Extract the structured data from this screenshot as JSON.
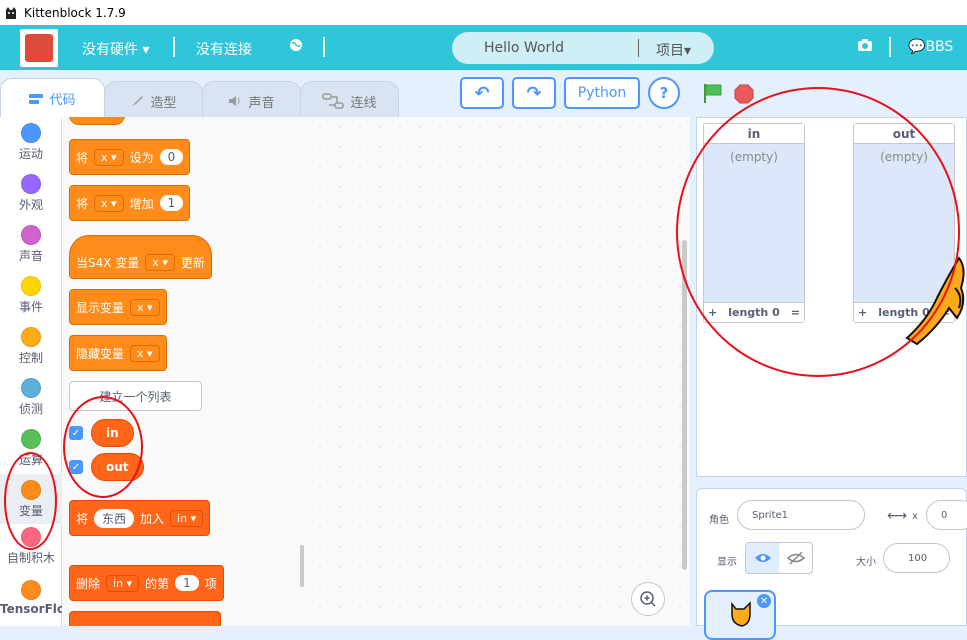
{
  "window": {
    "title": "Kittenblock 1.7.9"
  },
  "menubar": {
    "hardware": "没有硬件",
    "connection": "没有连接",
    "project_name": "Hello World",
    "project_menu": "项目",
    "bbs": "BBS"
  },
  "tabs": [
    "代码",
    "造型",
    "声音",
    "连线"
  ],
  "toolbar": {
    "undo": "↶",
    "redo": "↷",
    "python": "Python",
    "help": "?"
  },
  "categories": [
    {
      "label": "运动",
      "color": "#4c97ff"
    },
    {
      "label": "外观",
      "color": "#9966ff"
    },
    {
      "label": "声音",
      "color": "#cf63cf"
    },
    {
      "label": "事件",
      "color": "#ffd500"
    },
    {
      "label": "控制",
      "color": "#ffab19"
    },
    {
      "label": "侦测",
      "color": "#5cb1d6"
    },
    {
      "label": "运算",
      "color": "#59c059"
    },
    {
      "label": "变量",
      "color": "#ff8c1a"
    },
    {
      "label": "自制积木",
      "color": "#ff6680"
    },
    {
      "label": "TensorFlo",
      "color": "#ff8c1a"
    }
  ],
  "blocks": {
    "set_var": {
      "a": "将",
      "var": "x",
      "b": "设为",
      "val": "0"
    },
    "change_var": {
      "a": "将",
      "var": "x",
      "b": "增加",
      "val": "1"
    },
    "when_s4x": {
      "a": "当S4X 变量",
      "var": "x",
      "b": "更新"
    },
    "show_var": {
      "a": "显示变量",
      "var": "x"
    },
    "hide_var": {
      "a": "隐藏变量",
      "var": "x"
    },
    "make_list": "建立一个列表",
    "list_in": "in",
    "list_out": "out",
    "add_to_list": {
      "a": "将",
      "val": "东西",
      "b": "加入",
      "list": "in"
    },
    "delete_item": {
      "a": "删除",
      "list": "in",
      "b": "的第",
      "val": "1",
      "c": "项"
    }
  },
  "stage": {
    "monitor_in": {
      "name": "in",
      "empty": "(empty)",
      "plus": "+",
      "length": "length 0",
      "eq": "="
    },
    "monitor_out": {
      "name": "out",
      "empty": "(empty)",
      "plus": "+",
      "length": "length 0",
      "eq": "="
    }
  },
  "sprite": {
    "name_label": "角色",
    "name": "Sprite1",
    "x_label": "x",
    "x_value": "0",
    "show_label": "显示",
    "size_label": "大小",
    "size_value": "100"
  }
}
